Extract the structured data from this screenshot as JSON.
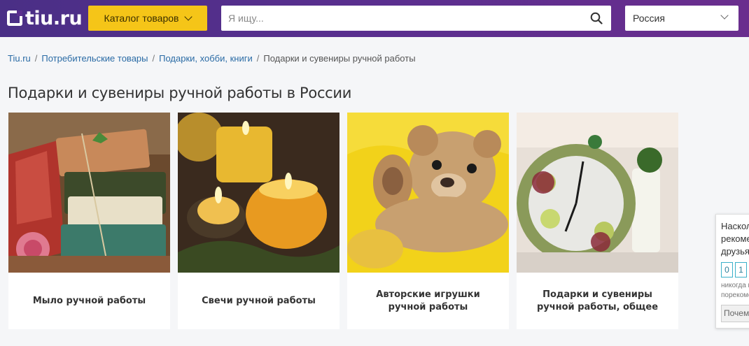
{
  "header": {
    "logo_text": "tiu.ru",
    "catalog_label": "Каталог товаров",
    "search_placeholder": "Я ищу...",
    "region": "Россия"
  },
  "breadcrumb": {
    "items": [
      "Tiu.ru",
      "Потребительские товары",
      "Подарки, хобби, книги"
    ],
    "current": "Подарки и сувениры ручной работы",
    "separator": "/"
  },
  "page_title": "Подарки и сувениры ручной работы в России",
  "categories": [
    {
      "label": "Мыло ручной работы",
      "image": "soap-photo"
    },
    {
      "label": "Свечи ручной работы",
      "image": "candles-photo"
    },
    {
      "label": "Авторские игрушки ручной работы",
      "image": "teddy-bear-photo"
    },
    {
      "label": "Подарки и сувениры ручной работы, общее",
      "image": "decorative-clock-photo"
    }
  ],
  "widget": {
    "question": [
      "Насколько вероятно, что вы",
      "рекомендуете нас",
      "друзьям?"
    ],
    "scale": [
      "0",
      "1"
    ],
    "low_label": [
      "никогда не",
      "порекомендую"
    ],
    "why_button": "Почему?"
  },
  "colors": {
    "header_gradient_start": "#4a2f86",
    "header_gradient_end": "#6a2e8e",
    "catalog_button": "#f5c518",
    "link": "#2a6ba5",
    "widget_accent": "#3bb0c9"
  }
}
